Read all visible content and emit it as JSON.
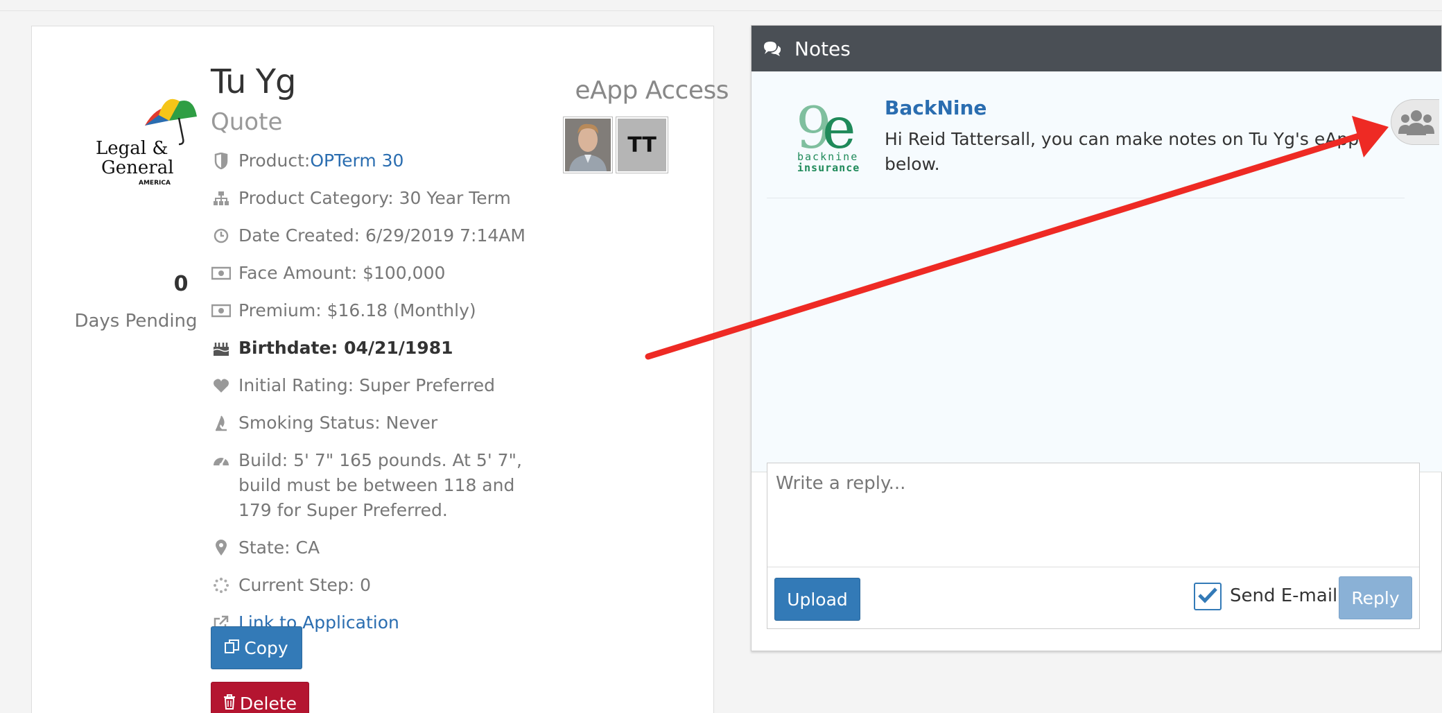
{
  "client": {
    "name": "Tu Yg",
    "status": "Quote"
  },
  "carrier": {
    "logo_line1": "Legal &",
    "logo_line2": "General",
    "logo_line3": "AMERICA"
  },
  "days_pending": {
    "count": "0",
    "label": "Days Pending"
  },
  "details": {
    "product_prefix": "Product: ",
    "product_link": "OPTerm 30",
    "product_category": "Product Category: 30 Year Term",
    "date_created": "Date Created: 6/29/2019 7:14AM",
    "face_amount": "Face Amount: $100,000",
    "premium": "Premium: $16.18 (Monthly)",
    "birthdate": "Birthdate: 04/21/1981",
    "initial_rating": "Initial Rating: Super Preferred",
    "smoking_status": "Smoking Status: Never",
    "build": "Build: 5' 7\" 165 pounds. At 5' 7\", build must be between 118 and 179 for Super Preferred.",
    "state": "State: CA",
    "current_step": "Current Step: 0",
    "link_to_application": "Link to Application"
  },
  "actions": {
    "copy_label": "Copy",
    "delete_label": "Delete"
  },
  "eapp_access": {
    "title": "eApp Access",
    "initials": "TT"
  },
  "notes": {
    "header": "Notes",
    "author": "BackNine",
    "logo_text_1": "backnine",
    "logo_text_2": "insurance",
    "message": "Hi Reid Tattersall, you can make notes on Tu Yg's eApp below.",
    "reply_placeholder": "Write a reply...",
    "upload_label": "Upload",
    "send_email_label": "Send E-mail",
    "send_email_checked": true,
    "reply_label": "Reply"
  },
  "colors": {
    "link": "#2a6db0",
    "primary": "#337ab7",
    "danger": "#b41530",
    "notes_header": "#4a4f55",
    "annotation_arrow": "#ee2a24"
  }
}
